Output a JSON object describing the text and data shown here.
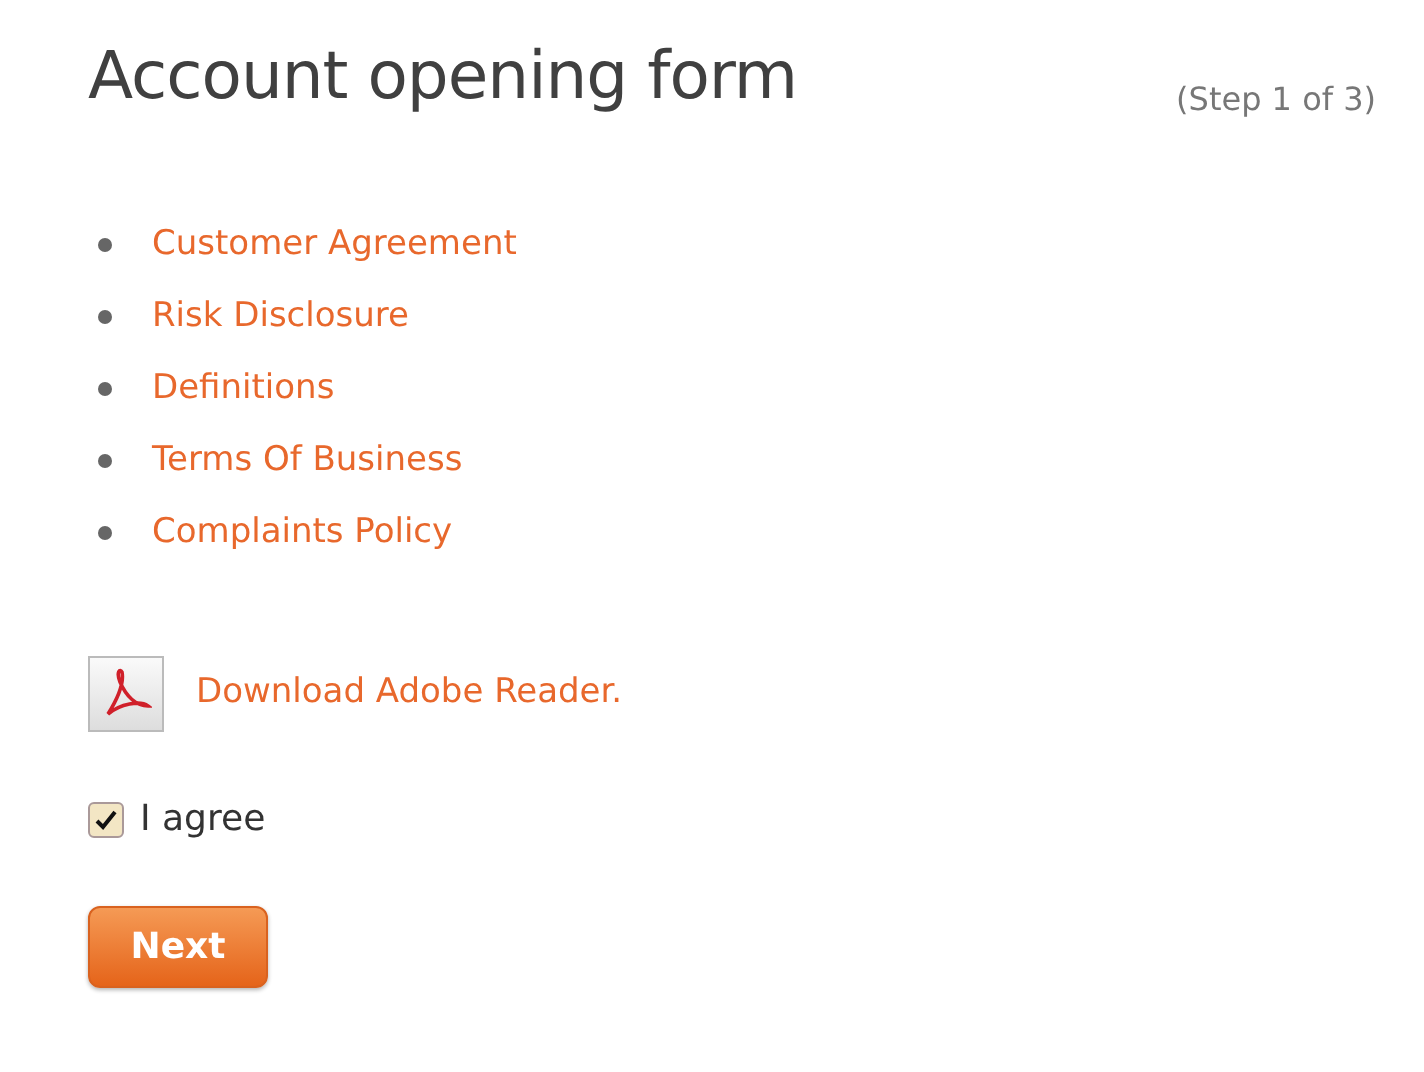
{
  "title": "Account opening form",
  "step": "(Step 1 of 3)",
  "documents": [
    {
      "label": "Customer Agreement"
    },
    {
      "label": "Risk Disclosure"
    },
    {
      "label": "Definitions"
    },
    {
      "label": "Terms Of Business"
    },
    {
      "label": "Complaints Policy"
    }
  ],
  "download_link": "Download Adobe Reader.",
  "agree": {
    "label": "I agree",
    "checked": true
  },
  "buttons": [
    {
      "label": "Next"
    }
  ]
}
